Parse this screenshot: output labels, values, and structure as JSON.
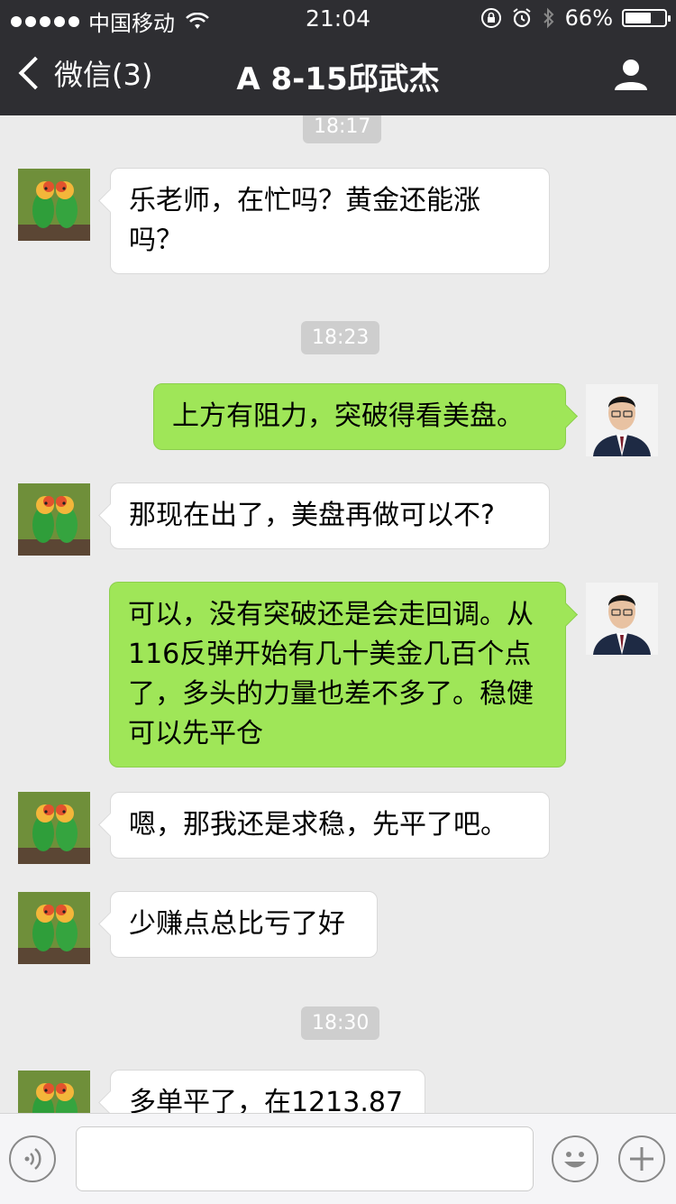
{
  "status_bar": {
    "carrier": "中国移动",
    "time": "21:04",
    "battery": "66%",
    "battery_level": 0.66
  },
  "nav": {
    "back_label": "微信(3)",
    "title": "A  8-15邱武杰"
  },
  "messages": [
    {
      "type": "timestamp",
      "text": "18:17"
    },
    {
      "type": "incoming",
      "text": "乐老师，在忙吗？黄金还能涨吗？"
    },
    {
      "type": "timestamp",
      "text": "18:23"
    },
    {
      "type": "outgoing",
      "text": "上方有阻力，突破得看美盘。"
    },
    {
      "type": "incoming",
      "text": "那现在出了，美盘再做可以不?"
    },
    {
      "type": "outgoing",
      "text": "可以，没有突破还是会走回调。从116反弹开始有几十美金几百个点了，多头的力量也差不多了。稳健可以先平仓"
    },
    {
      "type": "incoming",
      "text": "嗯，那我还是求稳，先平了吧。"
    },
    {
      "type": "incoming",
      "text": "少赚点总比亏了好"
    },
    {
      "type": "timestamp",
      "text": "18:30"
    },
    {
      "type": "incoming",
      "text": "多单平了，在1213.87"
    }
  ],
  "input_bar": {
    "voice_icon": "voice-icon",
    "emoji_icon": "emoji-icon",
    "plus_icon": "plus-icon"
  }
}
